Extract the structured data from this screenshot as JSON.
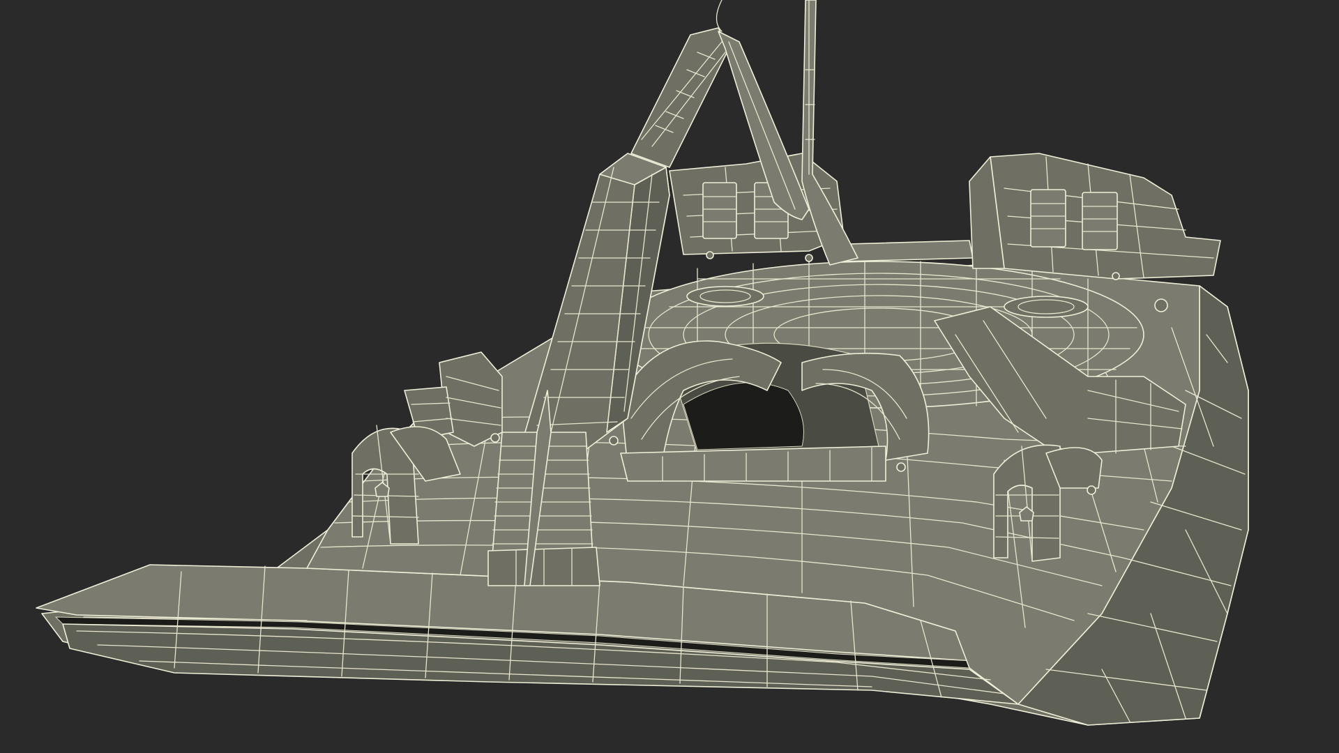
{
  "scene": {
    "subject": "wireframe-mesh-render",
    "background_color": "#2a2a2a",
    "mesh_fill_color": "#6f7063",
    "wire_color": "#e8e6cf"
  }
}
